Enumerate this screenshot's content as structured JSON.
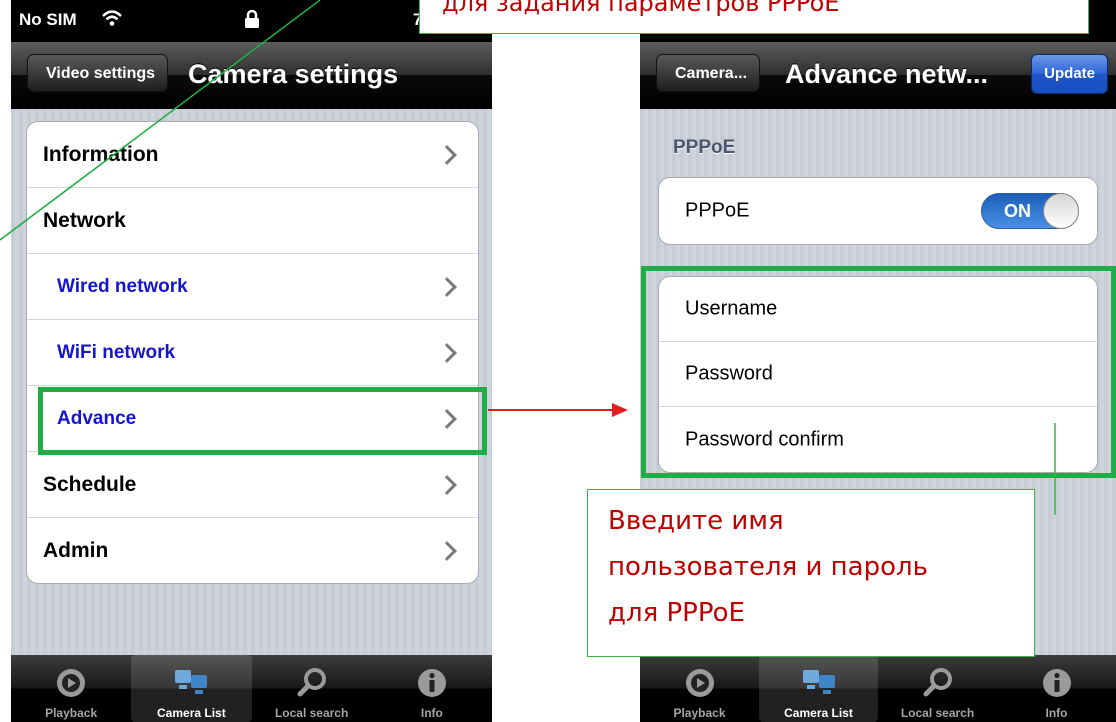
{
  "top_callout": {
    "text": "для задания параметров PPPoE"
  },
  "bottom_callout": {
    "lines": [
      "Введите имя",
      "пользователя и пароль",
      "для PPPoE"
    ]
  },
  "left_screen": {
    "status_bar": {
      "carrier": "No SIM",
      "time_partial": "7"
    },
    "nav": {
      "back_label": "Video settings",
      "title": "Camera settings"
    },
    "items": [
      {
        "label": "Information",
        "type": "header",
        "chevron": true
      },
      {
        "label": "Network",
        "type": "header",
        "chevron": false
      },
      {
        "label": "Wired network",
        "type": "sub",
        "chevron": true
      },
      {
        "label": "WiFi network",
        "type": "sub",
        "chevron": true
      },
      {
        "label": "Advance",
        "type": "sub",
        "chevron": true
      },
      {
        "label": "Schedule",
        "type": "header",
        "chevron": true
      },
      {
        "label": "Admin",
        "type": "header",
        "chevron": true
      }
    ],
    "tabs": [
      {
        "label": "Playback",
        "icon": "playback-icon"
      },
      {
        "label": "Camera List",
        "icon": "camera-list-icon",
        "active": true
      },
      {
        "label": "Local search",
        "icon": "search-icon"
      },
      {
        "label": "Info",
        "icon": "info-icon"
      }
    ]
  },
  "right_screen": {
    "nav": {
      "back_label": "Camera...",
      "title": "Advance netw...",
      "update_label": "Update"
    },
    "section_header": "PPPoE",
    "pppoe_toggle": {
      "label": "PPPoE",
      "state": "ON"
    },
    "fields": [
      {
        "label": "Username"
      },
      {
        "label": "Password"
      },
      {
        "label": "Password confirm"
      }
    ],
    "tabs": [
      {
        "label": "Playback",
        "icon": "playback-icon"
      },
      {
        "label": "Camera List",
        "icon": "camera-list-icon",
        "active": true
      },
      {
        "label": "Local search",
        "icon": "search-icon"
      },
      {
        "label": "Info",
        "icon": "info-icon"
      }
    ]
  },
  "colors": {
    "highlight_green": "#1fad45",
    "arrow_red": "#e02020",
    "link_blue": "#1515cf",
    "callout_text": "#c00000",
    "toggle_blue": "#2f7ad8"
  }
}
